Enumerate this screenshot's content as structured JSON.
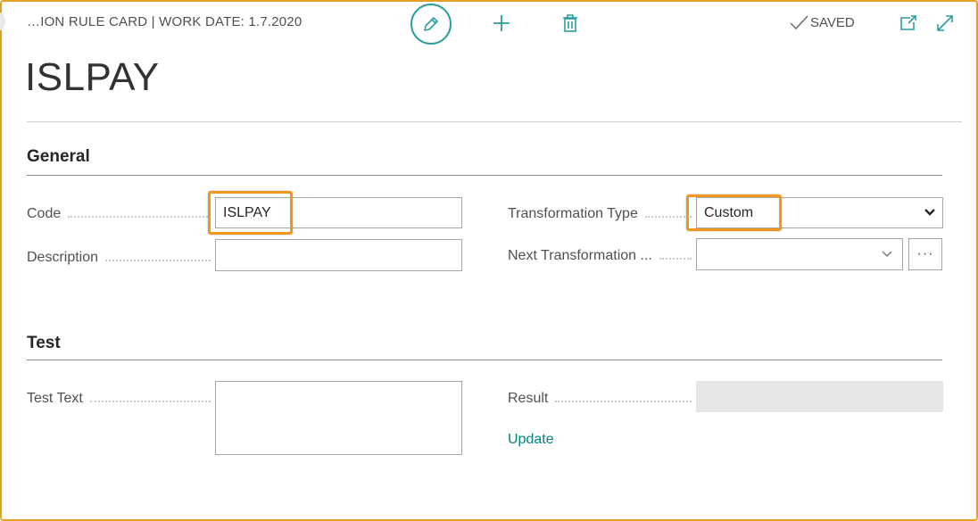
{
  "header": {
    "caption": "…ION RULE CARD | WORK DATE: 1.7.2020",
    "saved_label": "SAVED",
    "icons": [
      "edit-icon",
      "add-icon",
      "delete-icon",
      "check-icon",
      "open-new-window-icon",
      "expand-icon"
    ],
    "accent_color": "#2a9d9f"
  },
  "page": {
    "title": "ISLPAY"
  },
  "general": {
    "title": "General",
    "code_label": "Code",
    "code_value": "ISLPAY",
    "description_label": "Description",
    "description_value": "",
    "transformation_type_label": "Transformation Type",
    "transformation_type_value": "Custom",
    "next_transformation_label": "Next Transformation ...",
    "next_transformation_value": "",
    "lookup_label": "···"
  },
  "test": {
    "title": "Test",
    "test_text_label": "Test Text",
    "test_text_value": "",
    "result_label": "Result",
    "result_value": "",
    "update_label": "Update"
  },
  "highlight_color": "#f0961e"
}
